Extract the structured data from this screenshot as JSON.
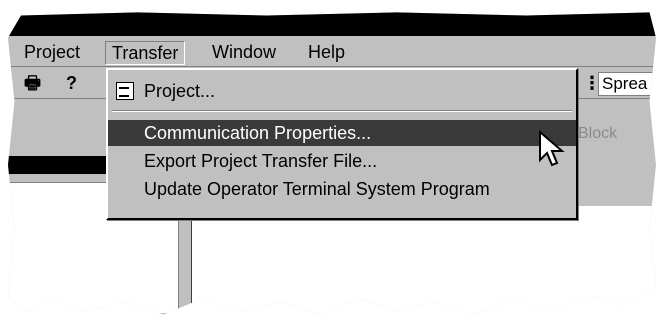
{
  "menubar": {
    "items": [
      "Project",
      "Transfer",
      "Window",
      "Help"
    ]
  },
  "toolbar": {
    "combo_value": "Sprea",
    "grey_label": "Block"
  },
  "dropdown": {
    "items": [
      {
        "label": "Project...",
        "icon": "project-icon"
      },
      {
        "label": "Communication Properties..."
      },
      {
        "label": "Export Project Transfer File..."
      },
      {
        "label": "Update Operator Terminal System Program"
      }
    ]
  },
  "colors": {
    "menu_bg": "#c0c0c0",
    "highlight_bg": "#3a3a3a",
    "title_bg": "#000000"
  }
}
